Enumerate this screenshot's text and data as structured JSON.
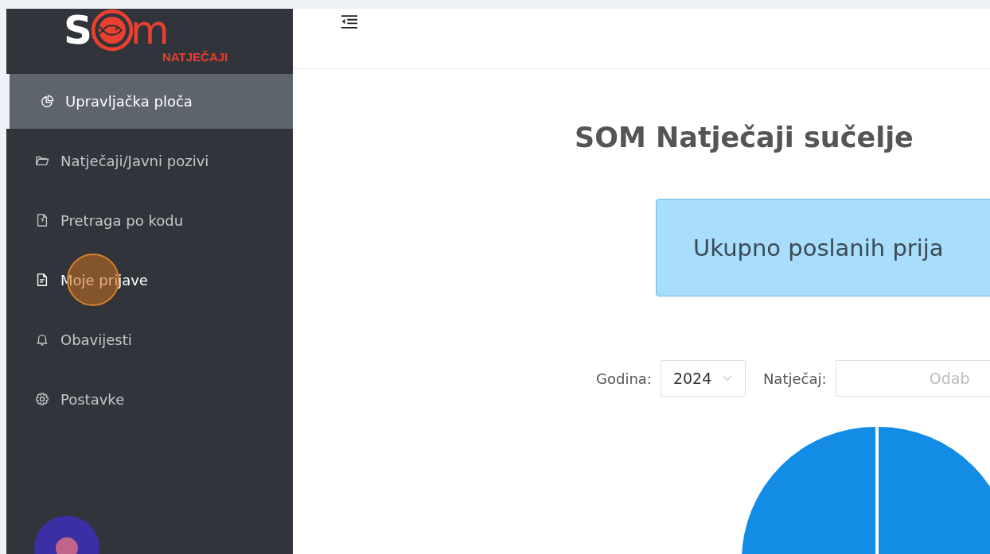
{
  "logo": {
    "letter_1": "S",
    "letter_2": "m",
    "subtitle": "NATJEČAJI"
  },
  "sidebar": {
    "items": [
      {
        "label": "Upravljačka ploča",
        "selected": true
      },
      {
        "label": "Natječaji/Javni pozivi",
        "selected": false
      },
      {
        "label": "Pretraga po kodu",
        "selected": false
      },
      {
        "label": "Moje prijave",
        "selected": false
      },
      {
        "label": "Obavijesti",
        "selected": false
      },
      {
        "label": "Postavke",
        "selected": false
      }
    ]
  },
  "page": {
    "title": "SOM Natječaji sučelje",
    "summary": "Ukupno poslanih prija",
    "filters": {
      "year_label": "Godina:",
      "year_value": "2024",
      "competition_label": "Natječaj:",
      "competition_placeholder": "Odab"
    }
  }
}
